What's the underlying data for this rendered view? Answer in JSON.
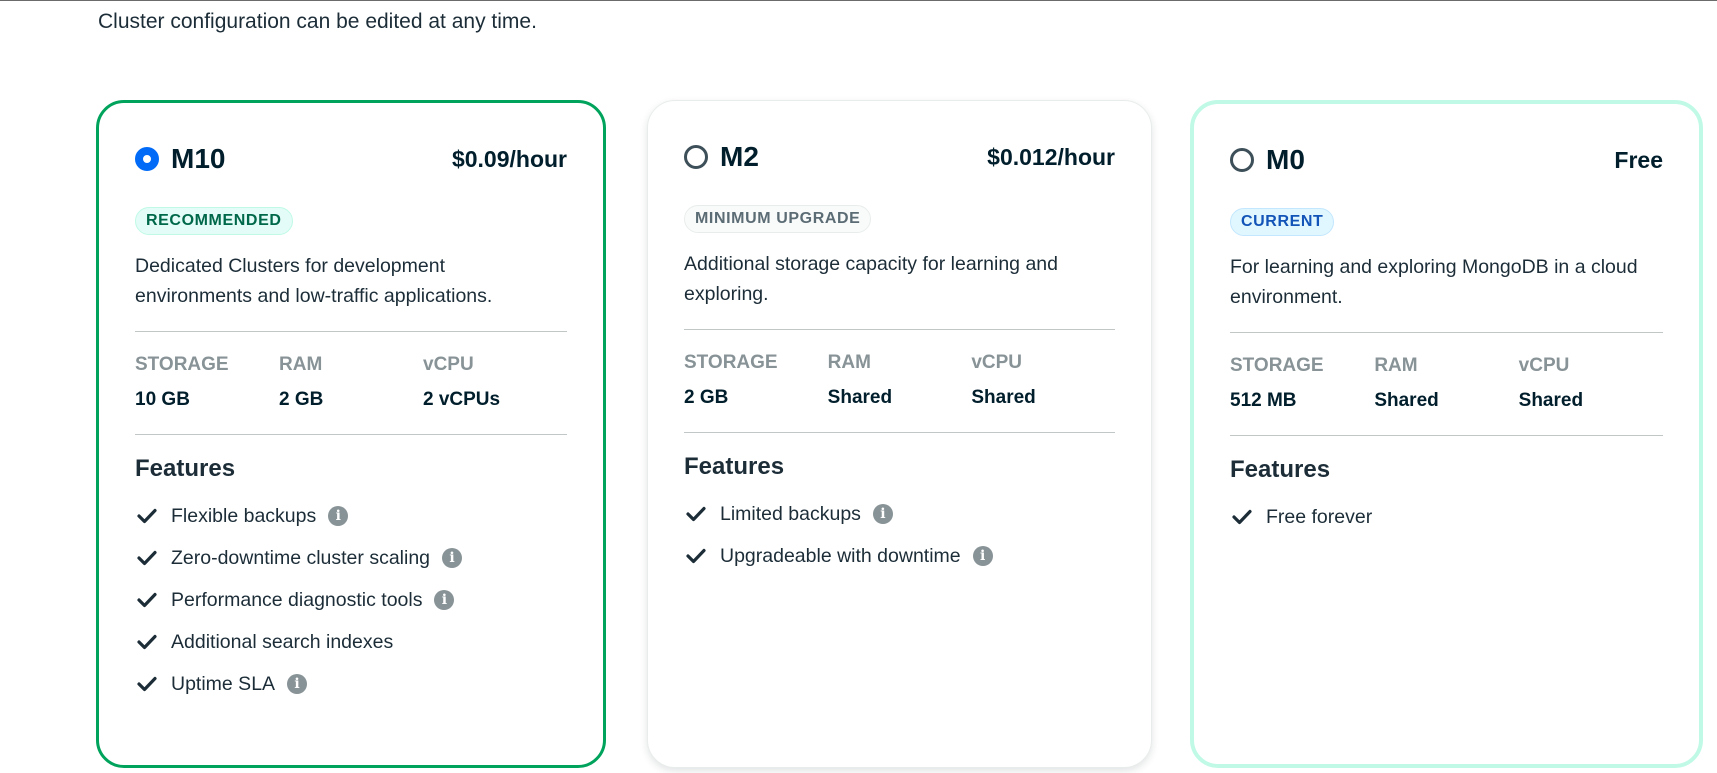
{
  "intro_text": "Cluster configuration can be edited at any time.",
  "spec_labels": {
    "storage": "STORAGE",
    "ram": "RAM",
    "vcpu": "vCPU"
  },
  "features_heading": "Features",
  "colors": {
    "selected_border": "#00a35c",
    "current_border": "#c0fae6",
    "radio_selected": "#016bf8"
  },
  "cards": [
    {
      "tier": "M10",
      "price": "$0.09/hour",
      "selected": true,
      "badge": "RECOMMENDED",
      "description": "Dedicated Clusters for development environments and low-traffic applications.",
      "storage": "10 GB",
      "ram": "2 GB",
      "vcpu": "2 vCPUs",
      "features": [
        {
          "label": "Flexible backups",
          "info": true
        },
        {
          "label": "Zero-downtime cluster scaling",
          "info": true
        },
        {
          "label": "Performance diagnostic tools",
          "info": true
        },
        {
          "label": "Additional search indexes",
          "info": false
        },
        {
          "label": "Uptime SLA",
          "info": true
        }
      ]
    },
    {
      "tier": "M2",
      "price": "$0.012/hour",
      "selected": false,
      "badge": "MINIMUM UPGRADE",
      "description": "Additional storage capacity for learning and exploring.",
      "storage": "2 GB",
      "ram": "Shared",
      "vcpu": "Shared",
      "features": [
        {
          "label": "Limited backups",
          "info": true
        },
        {
          "label": "Upgradeable with downtime",
          "info": true
        }
      ]
    },
    {
      "tier": "M0",
      "price": "Free",
      "selected": false,
      "badge": "CURRENT",
      "description": "For learning and exploring MongoDB in a cloud environment.",
      "storage": "512 MB",
      "ram": "Shared",
      "vcpu": "Shared",
      "features": [
        {
          "label": "Free forever",
          "info": false
        }
      ]
    }
  ]
}
